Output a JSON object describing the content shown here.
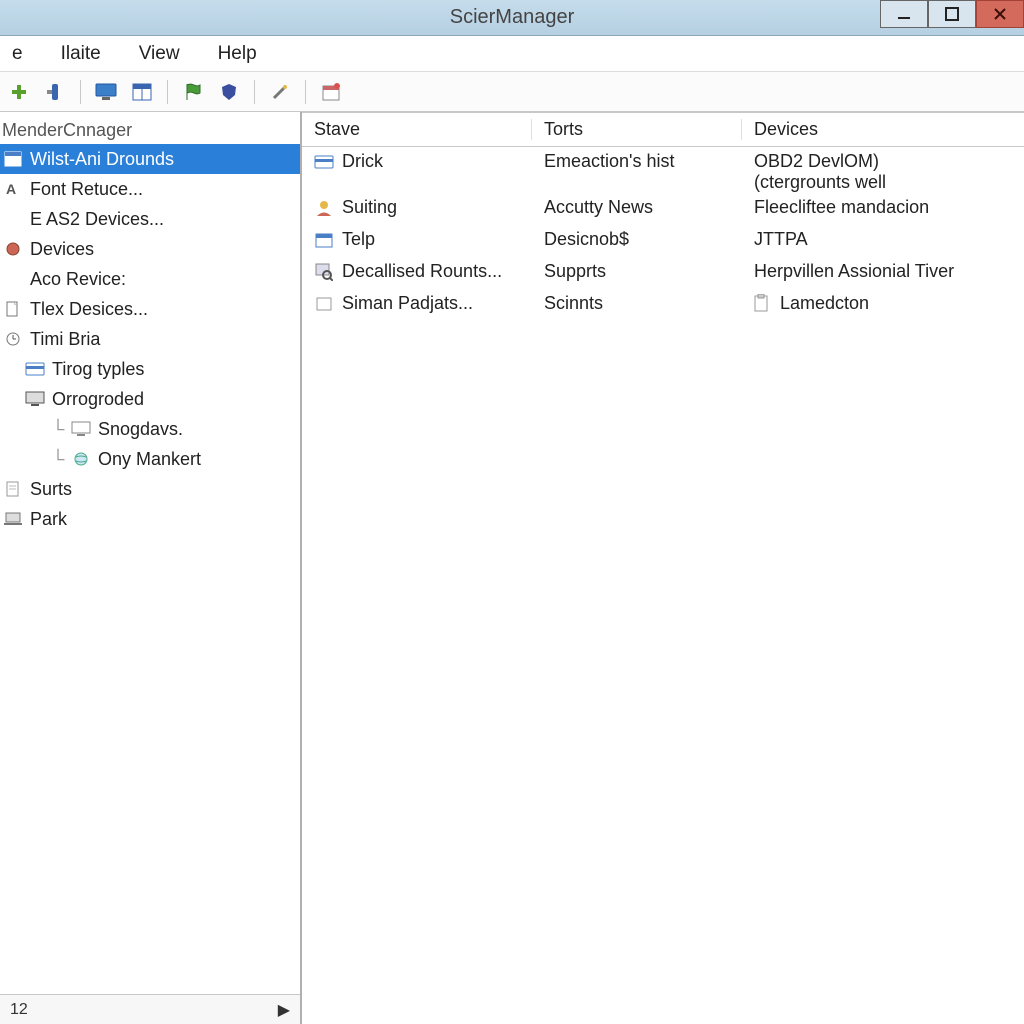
{
  "window": {
    "title": "ScierManager"
  },
  "menubar": {
    "items": [
      "e",
      "Ilaite",
      "View",
      "Help"
    ]
  },
  "toolbar": {
    "icons": [
      "add-icon",
      "connect-icon",
      "monitor-icon",
      "sheet-icon",
      "flag-icon",
      "shield-icon",
      "wand-icon",
      "calendar-icon"
    ]
  },
  "tree": {
    "header": "MenderCnnager",
    "items": [
      {
        "label": "Wilst-Ani Drounds",
        "indent": 0,
        "icon": "window-icon",
        "selected": true
      },
      {
        "label": "Font Retuce...",
        "indent": 0,
        "icon": "font-icon"
      },
      {
        "label": "E AS2 Devices...",
        "indent": 0,
        "icon": "none"
      },
      {
        "label": "Devices",
        "indent": 0,
        "icon": "device-icon"
      },
      {
        "label": "Aco Revice:",
        "indent": 0,
        "icon": "none"
      },
      {
        "label": "Tlex Desices...",
        "indent": 0,
        "icon": "doc-icon"
      },
      {
        "label": "Timi Bria",
        "indent": 0,
        "icon": "clock-icon"
      },
      {
        "label": "Tirog typles",
        "indent": 1,
        "icon": "card-icon"
      },
      {
        "label": "Orrogroded",
        "indent": 1,
        "icon": "monitor-icon"
      },
      {
        "label": "Snogdavs.",
        "indent": 2,
        "icon": "monitor-outline-icon",
        "conn": true
      },
      {
        "label": "Ony Mankert",
        "indent": 2,
        "icon": "globe-icon",
        "conn": true
      },
      {
        "label": "Surts",
        "indent": 0,
        "icon": "page-icon"
      },
      {
        "label": "Park",
        "indent": 0,
        "icon": "laptop-icon"
      }
    ]
  },
  "sidebar_footer": {
    "page": "12",
    "arrow": "▶"
  },
  "list": {
    "columns": [
      "Stave",
      "Torts",
      "Devices"
    ],
    "rows": [
      {
        "icon": "card-icon",
        "c1": "Drick",
        "c2": "Emeaction's hist",
        "c3a": "OBD2 DevlOM)",
        "c3b": "(ctergrounts well"
      },
      {
        "icon": "user-icon",
        "c1": "Suiting",
        "c2": "Accutty News",
        "c3a": "Fleecliftee mandacion",
        "c3b": ""
      },
      {
        "icon": "cal-icon",
        "c1": "Telp",
        "c2": "Desicnob$",
        "c3a": "JTTPA",
        "c3b": ""
      },
      {
        "icon": "search-icon",
        "c1": "Decallised Rounts...",
        "c2": "Supprts",
        "c3a": "Herpvillen Assionial Tiver",
        "c3b": ""
      },
      {
        "icon": "box-icon",
        "c1": "Siman Padjats...",
        "c2": "Scinnts",
        "c3a": "Lamedcton",
        "c3b": "",
        "c3icon": "clipboard-icon"
      }
    ]
  }
}
